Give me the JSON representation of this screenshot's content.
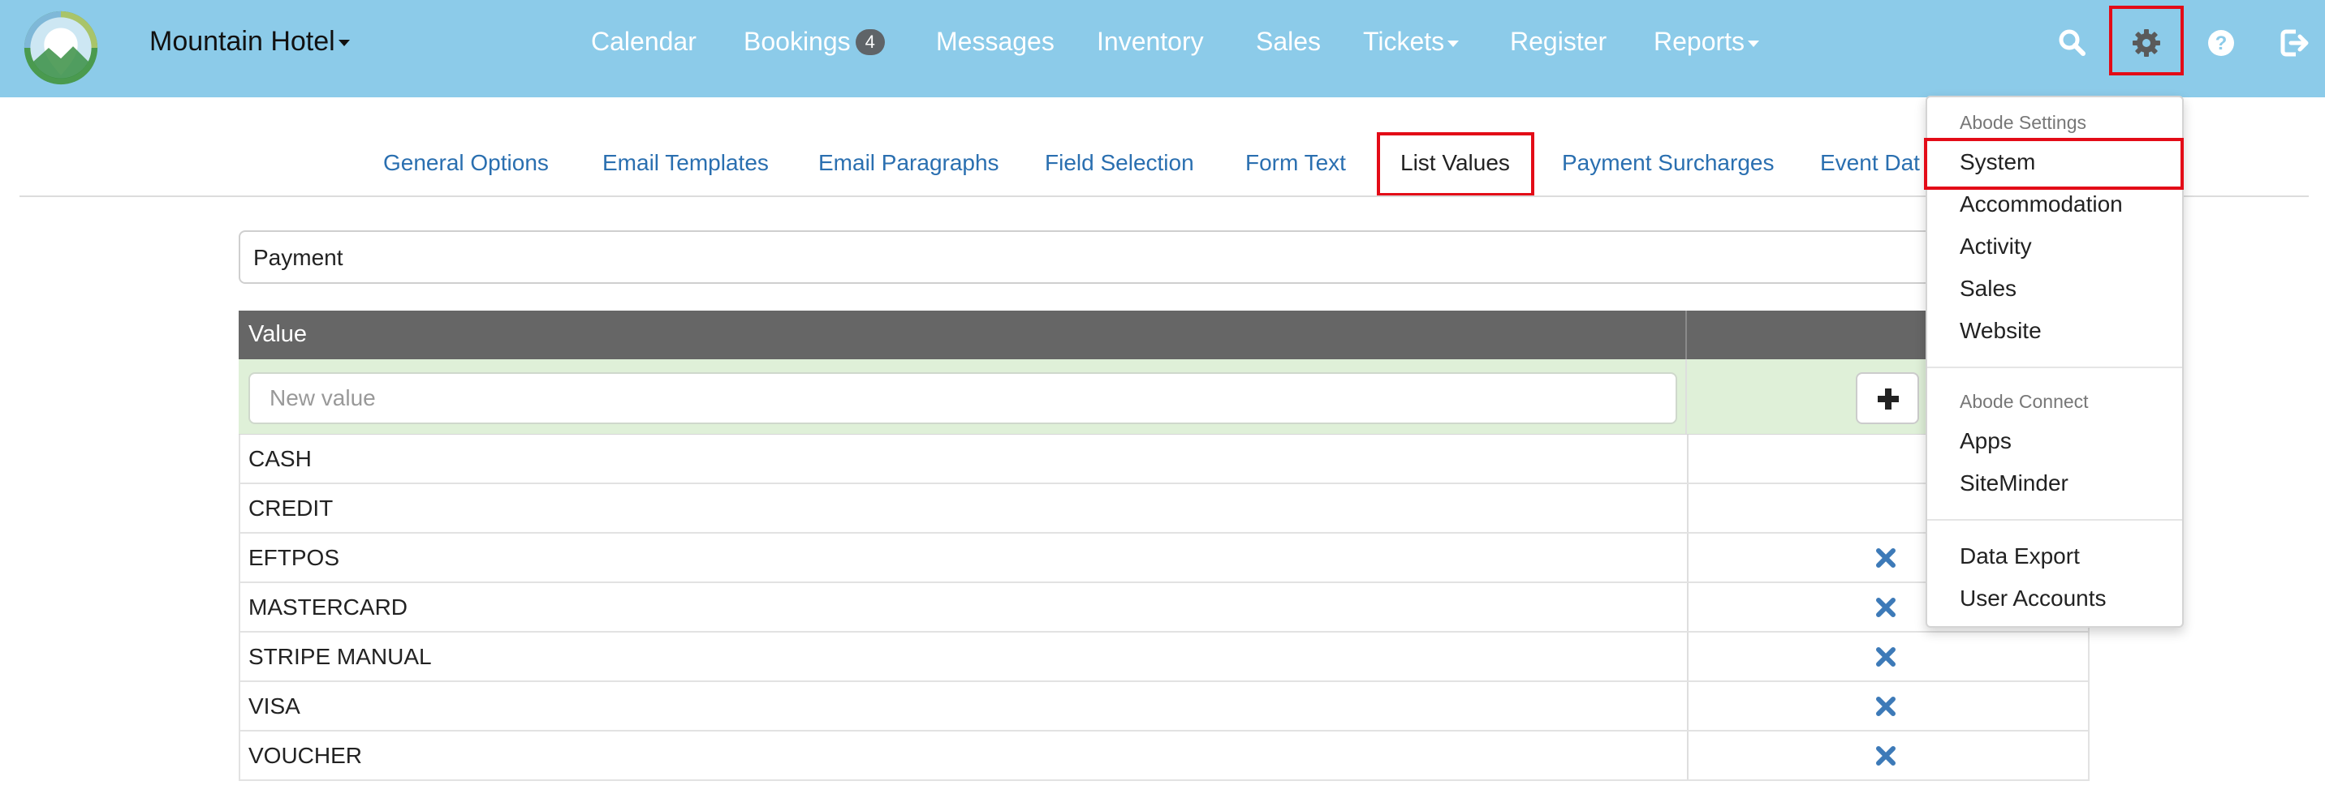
{
  "colors": {
    "navbar": "#8ccbe9",
    "link": "#2a6fb0",
    "table_header": "#666666",
    "new_row": "#dff0d8",
    "highlight": "#e30b17",
    "delete_icon": "#3d7ab8"
  },
  "navbar": {
    "hotel_name": "Mountain Hotel",
    "items": [
      {
        "label": "Calendar"
      },
      {
        "label": "Bookings",
        "badge": "4"
      },
      {
        "label": "Messages"
      },
      {
        "label": "Inventory"
      },
      {
        "label": "Sales"
      },
      {
        "label": "Tickets"
      },
      {
        "label": "Register"
      },
      {
        "label": "Reports"
      }
    ],
    "icons": [
      "search-icon",
      "gear-icon",
      "help-icon",
      "logout-icon"
    ]
  },
  "tabs": [
    {
      "label": "General Options"
    },
    {
      "label": "Email Templates"
    },
    {
      "label": "Email Paragraphs"
    },
    {
      "label": "Field Selection"
    },
    {
      "label": "Form Text"
    },
    {
      "label": "List Values",
      "active": true
    },
    {
      "label": "Payment Surcharges"
    },
    {
      "label": "Event Dat"
    }
  ],
  "list_select": {
    "value": "Payment"
  },
  "table": {
    "header": "Value",
    "new_value_placeholder": "New value",
    "add_icon": "plus-icon",
    "rows": [
      {
        "value": "CASH",
        "deletable": false
      },
      {
        "value": "CREDIT",
        "deletable": false
      },
      {
        "value": "EFTPOS",
        "deletable": true
      },
      {
        "value": "MASTERCARD",
        "deletable": true
      },
      {
        "value": "STRIPE MANUAL",
        "deletable": true
      },
      {
        "value": "VISA",
        "deletable": true
      },
      {
        "value": "VOUCHER",
        "deletable": true
      }
    ]
  },
  "settings_menu": {
    "sections": [
      {
        "header": "Abode Settings",
        "items": [
          "System",
          "Accommodation",
          "Activity",
          "Sales",
          "Website"
        ]
      },
      {
        "header": "Abode Connect",
        "items": [
          "Apps",
          "SiteMinder"
        ]
      },
      {
        "header": "",
        "items": [
          "Data Export",
          "User Accounts"
        ]
      }
    ],
    "highlighted": "System"
  }
}
